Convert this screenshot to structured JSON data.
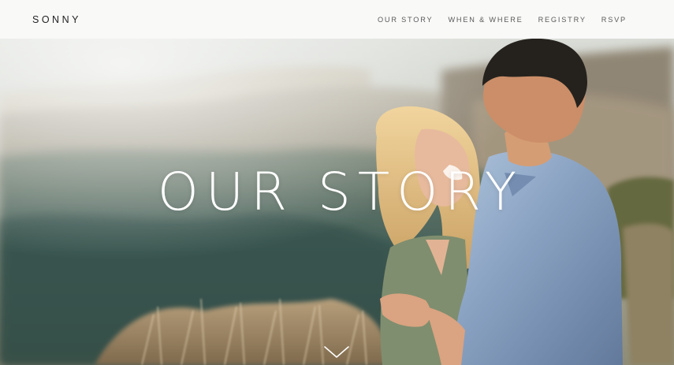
{
  "header": {
    "logo": "SONNY",
    "nav": [
      {
        "label": "OUR STORY"
      },
      {
        "label": "WHEN & WHERE"
      },
      {
        "label": "REGISTRY"
      },
      {
        "label": "RSVP"
      }
    ]
  },
  "hero": {
    "title": "OUR STORY",
    "scroll_icon": "chevron-down-icon"
  },
  "colors": {
    "header_bg": "#f9f9f8",
    "logo": "#222222",
    "nav_text": "#5a5a5a",
    "hero_title": "#ffffff"
  }
}
